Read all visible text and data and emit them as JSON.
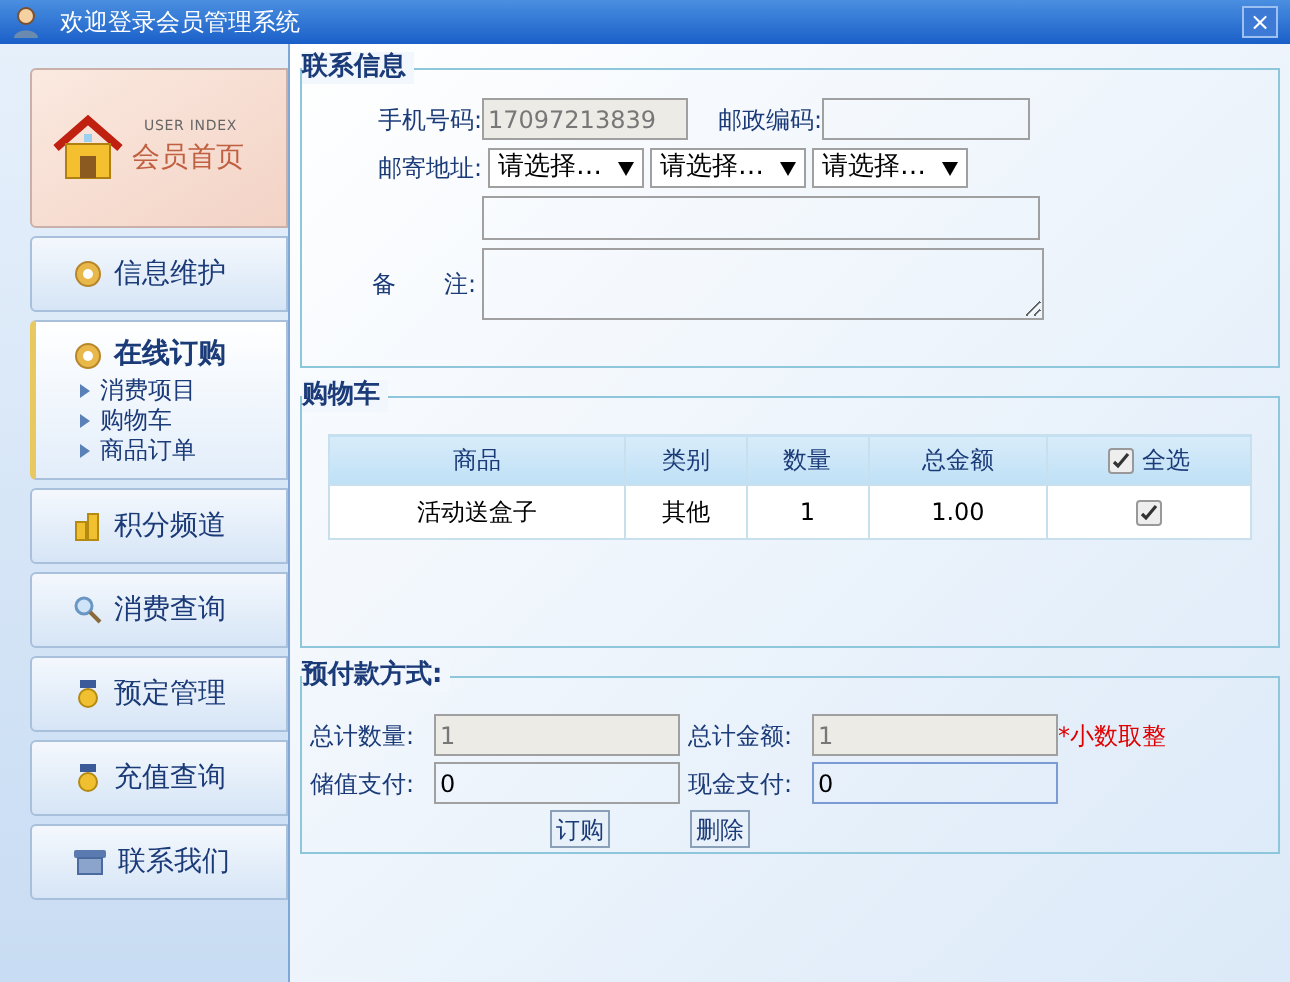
{
  "window": {
    "title": "欢迎登录会员管理系统",
    "close": "×"
  },
  "sidebar": {
    "home": {
      "caption_en": "USER INDEX",
      "caption": "会员首页"
    },
    "items": [
      {
        "label": "信息维护",
        "selected": false
      },
      {
        "label": "在线订购",
        "selected": true,
        "children": [
          "消费项目",
          "购物车",
          "商品订单"
        ]
      },
      {
        "label": "积分频道",
        "selected": false
      },
      {
        "label": "消费查询",
        "selected": false
      },
      {
        "label": "预定管理",
        "selected": false
      },
      {
        "label": "充值查询",
        "selected": false
      },
      {
        "label": "联系我们",
        "selected": false
      }
    ]
  },
  "contact": {
    "title": "联系信息",
    "phone_label": "手机号码:",
    "phone": "17097213839",
    "zip_label": "邮政编码:",
    "address_label": "邮寄地址:",
    "selects": [
      "请选择…",
      "请选择…",
      "请选择…"
    ],
    "remark_label": "备　　注:"
  },
  "cart": {
    "title": "购物车",
    "columns": [
      "商品",
      "类别",
      "数量",
      "总金额",
      "全选"
    ],
    "select_all_checked": true,
    "rows": [
      {
        "cells": [
          "活动送盒子",
          "其他",
          "1",
          "1.00"
        ],
        "checked": true
      }
    ]
  },
  "payment": {
    "title": "预付款方式:",
    "total_qty_label": "总计数量:",
    "total_qty": "1",
    "total_amount_label": "总计金额:",
    "total_amount": "1",
    "note": "*小数取整",
    "stored_label": "储值支付:",
    "stored": "0",
    "cash_label": "现金支付:",
    "cash": "0",
    "buttons": [
      "订购",
      "删除"
    ]
  }
}
